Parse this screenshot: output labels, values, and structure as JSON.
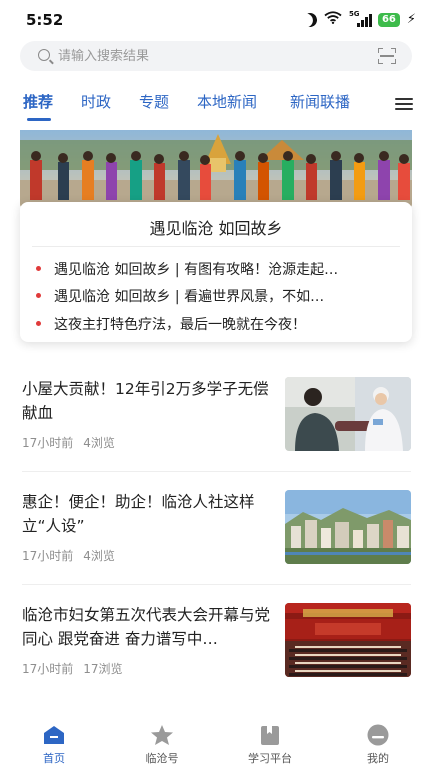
{
  "status_bar": {
    "time": "5:52",
    "signal_label": "5G",
    "battery": "66",
    "icons": [
      "moon-icon",
      "wifi-icon",
      "signal-icon",
      "battery-icon",
      "charging-icon"
    ]
  },
  "search": {
    "placeholder": "请输入搜索结果",
    "scan_icon": "scan-icon"
  },
  "tabs": [
    {
      "label": "推荐",
      "active": true
    },
    {
      "label": "时政",
      "active": false
    },
    {
      "label": "专题",
      "active": false
    },
    {
      "label": "本地新闻",
      "active": false
    },
    {
      "label": "新闻联播",
      "active": false
    }
  ],
  "feature": {
    "title": "遇见临沧 如回故乡",
    "items": [
      "遇见临沧 如回故乡 | 有图有攻略！沧源走起…",
      "遇见临沧 如回故乡 | 看遍世界风景，不如…",
      "这夜主打特色疗法，最后一晚就在今夜！"
    ]
  },
  "news": [
    {
      "title": "小屋大贡献！12年引2万多学子无偿献血",
      "time": "17小时前",
      "views": "4浏览"
    },
    {
      "title": "惠企！便企！助企！临沧人社这样立“人设”",
      "time": "17小时前",
      "views": "4浏览"
    },
    {
      "title": "临沧市妇女第五次代表大会开幕与党同心 跟党奋进 奋力谱写中…",
      "time": "17小时前",
      "views": "17浏览"
    }
  ],
  "bottom_nav": [
    {
      "label": "首页",
      "icon": "home-icon",
      "active": true
    },
    {
      "label": "临沧号",
      "icon": "star-icon",
      "active": false
    },
    {
      "label": "学习平台",
      "icon": "book-icon",
      "active": false
    },
    {
      "label": "我的",
      "icon": "profile-icon",
      "active": false
    }
  ],
  "colors": {
    "accent": "#2d66c4",
    "bullet": "#e03a3a",
    "battery": "#3dbb4b"
  }
}
